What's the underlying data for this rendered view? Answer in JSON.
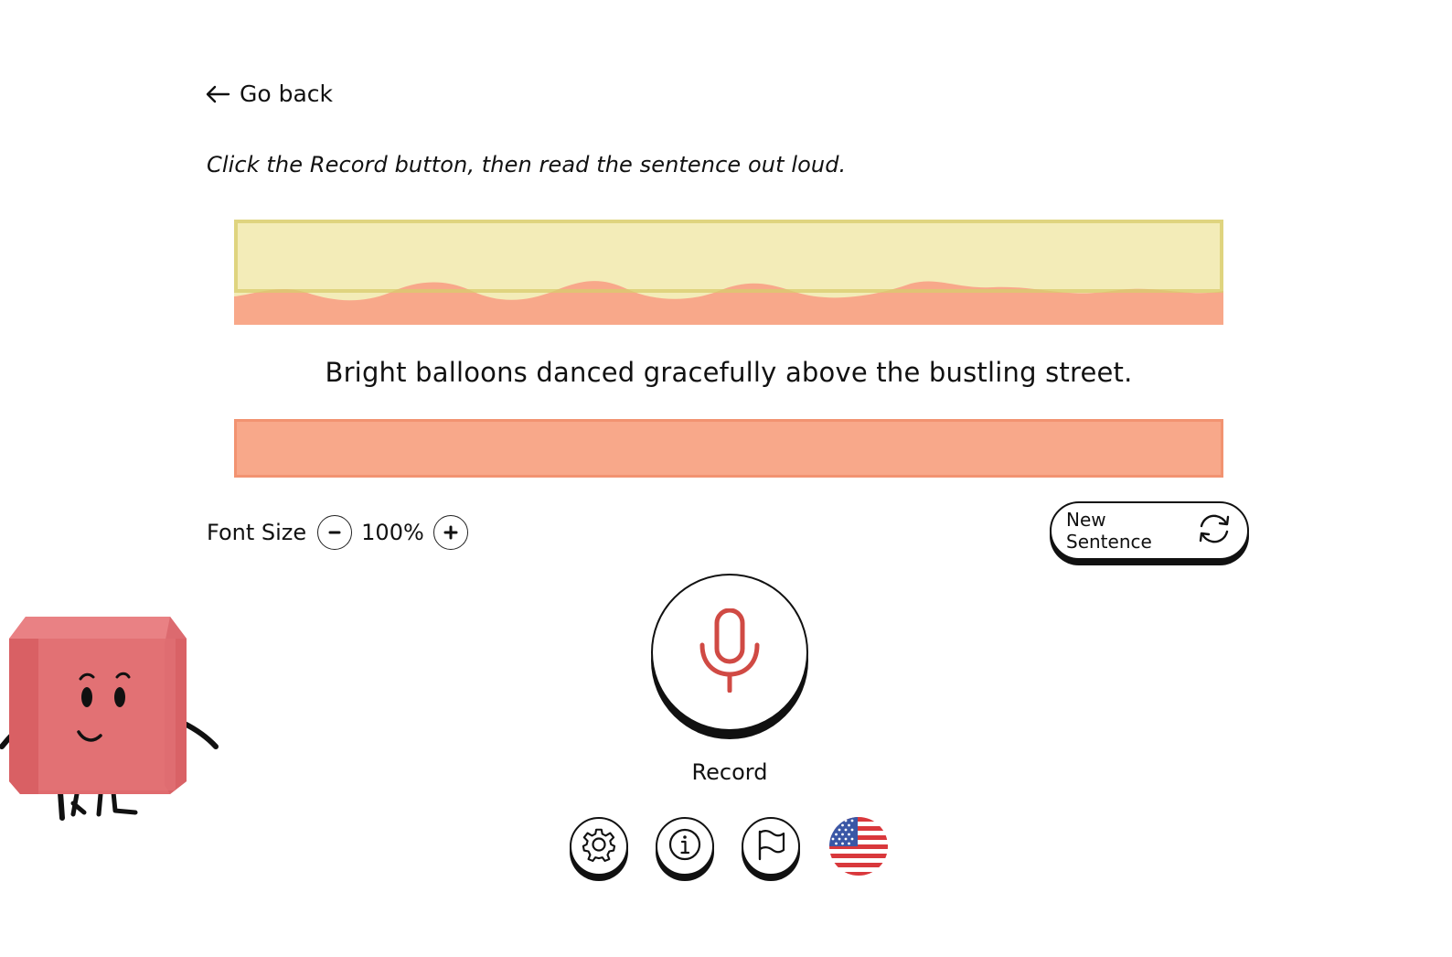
{
  "nav": {
    "back_label": "Go back",
    "back_icon": "arrow-left-icon"
  },
  "instruction": "Click the Record button, then read the sentence out loud.",
  "sentence": "Bright balloons danced gracefully above the bustling street.",
  "font_size": {
    "label": "Font Size",
    "value": "100%",
    "decrease_icon": "minus-icon",
    "increase_icon": "plus-icon"
  },
  "new_sentence": {
    "label": "New Sentence",
    "icon": "refresh-icon"
  },
  "record": {
    "label": "Record",
    "icon": "microphone-icon"
  },
  "tools": [
    {
      "name": "settings",
      "icon": "gear-icon"
    },
    {
      "name": "info",
      "icon": "info-icon"
    },
    {
      "name": "report",
      "icon": "flag-icon"
    },
    {
      "name": "language",
      "icon": "us-flag-icon"
    }
  ],
  "colors": {
    "band_yellow": "#f3ecb8",
    "band_yellow_border": "#d8cc6c",
    "band_salmon": "#f8a88a",
    "mic_red": "#d04a44",
    "mascot_red": "#e06b6e"
  }
}
